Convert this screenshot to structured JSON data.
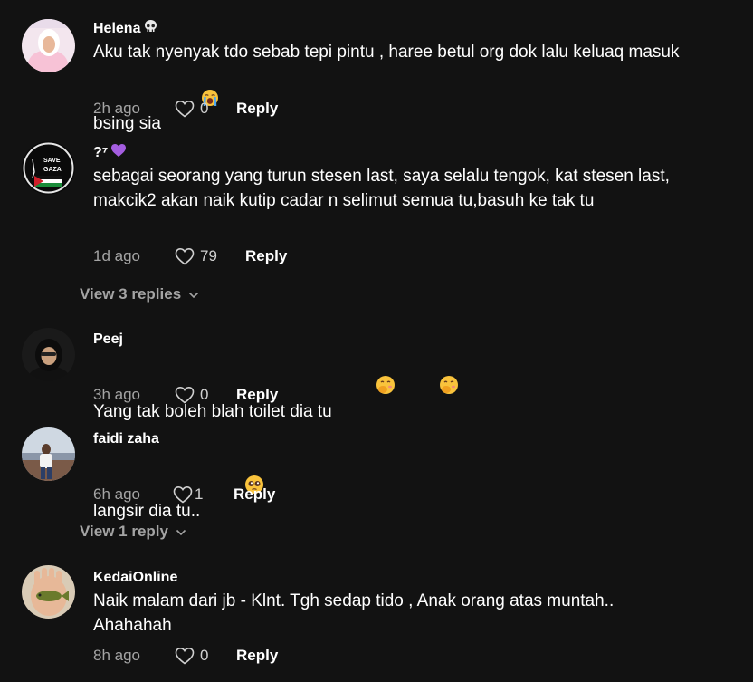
{
  "comments": [
    {
      "username": "Helena",
      "username_suffix_icon": "skull-emoji",
      "text": "Aku tak nyenyak tdo sebab tepi pintu , haree betul org dok lalu keluaq masuk bsing sia",
      "text_end_emoji": "crying-face-emoji",
      "time": "2h ago",
      "likes": "0",
      "reply_label": "Reply"
    },
    {
      "username": "?⁷",
      "username_suffix_icon": "purple-heart-emoji",
      "avatar_text_1": "SAVE",
      "avatar_text_2": "GAZA",
      "text": "sebagai seorang yang turun stesen last, saya selalu tengok, kat stesen last, makcik2 akan naik kutip cadar n selimut semua tu,basuh ke tak tu",
      "time": "1d ago",
      "likes": "79",
      "reply_label": "Reply",
      "view_replies": "View 3 replies"
    },
    {
      "username": "Peej",
      "text": "Yang tak boleh blah toilet dia tu",
      "text_end_emoji": "face-with-hand-over-mouth-emoji",
      "time": "3h ago",
      "likes": "0",
      "reply_label": "Reply"
    },
    {
      "username": "faidi zaha",
      "text": "langsir dia tu..",
      "text_end_emoji": "pleading-face-emoji",
      "time": "6h ago",
      "likes": "1",
      "reply_label": "Reply",
      "view_replies": "View 1 reply"
    },
    {
      "username": "KedaiOnline",
      "text": "Naik malam dari jb - Klnt. Tgh sedap tido , Anak orang atas muntah.. Ahahahah",
      "time": "8h ago",
      "likes": "0",
      "reply_label": "Reply"
    }
  ],
  "colors": {
    "background": "#121212",
    "username": "#ffffff",
    "text": "#ffffff",
    "meta": "#a4a4a4",
    "reply": "#ffffff"
  }
}
